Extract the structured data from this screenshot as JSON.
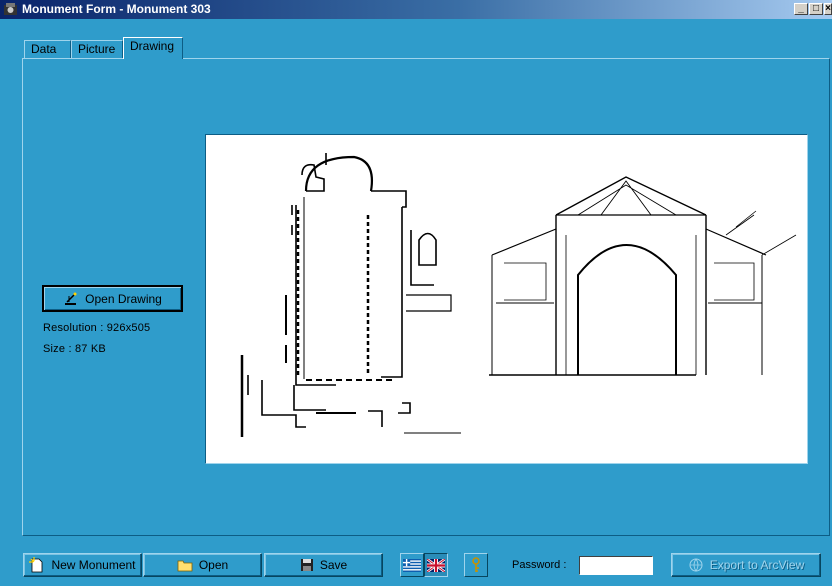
{
  "window": {
    "title": "Monument Form - Monument 303"
  },
  "tabs": [
    {
      "label": "Data"
    },
    {
      "label": "Picture"
    },
    {
      "label": "Drawing"
    }
  ],
  "drawing_panel": {
    "open_button_label": "Open Drawing",
    "resolution_text": "Resolution : 926x505",
    "size_text": "Size : 87 KB"
  },
  "toolbar": {
    "new_label": "New Monument",
    "open_label": "Open",
    "save_label": "Save",
    "password_label": "Password :",
    "password_value": "",
    "export_label": "Export to ArcView"
  },
  "colors": {
    "panel_bg": "#2f9ccb",
    "title_bar": "#0a246a"
  }
}
